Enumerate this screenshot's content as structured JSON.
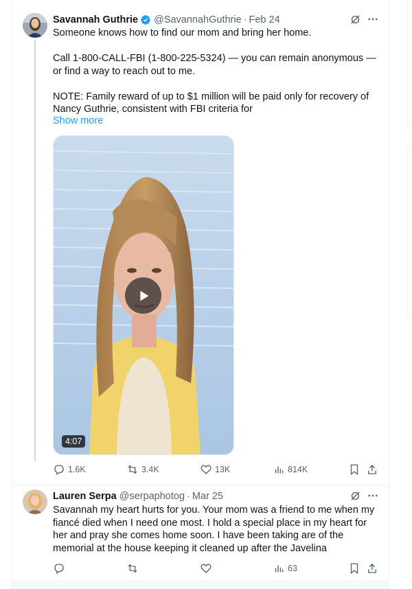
{
  "tweets": [
    {
      "author": "Savannah Guthrie",
      "handle": "@SavannahGuthrie",
      "separator": "·",
      "date": "Feb 24",
      "verified": true,
      "text": [
        "Someone knows how to find our mom and bring her home.",
        "Call 1-800-CALL-FBI (1-800-225-5324) — you can remain anonymous — or find a way to reach out to me.",
        "NOTE: Family reward of up to $1 million will be paid only for recovery of Nancy Guthrie, consistent with FBI criteria for"
      ],
      "show_more": "Show more",
      "video": {
        "duration": "4:07",
        "icon": "play-icon"
      },
      "stats": {
        "replies": "1.6K",
        "reposts": "3.4K",
        "likes": "13K",
        "views": "814K"
      }
    },
    {
      "author": "Lauren Serpa",
      "handle": "@serpaphotog",
      "separator": "·",
      "date": "Mar 25",
      "verified": false,
      "text": [
        "Savannah my heart hurts for you. Your mom was a friend to me when my fiancé  died when I need one most. I hold a special place in my heart for her and pray she comes home soon. I have been taking are of the memorial at the house keeping it cleaned up after the Javelina"
      ],
      "stats": {
        "replies": "",
        "reposts": "",
        "likes": "",
        "views": "63"
      }
    }
  ],
  "icons": {
    "grok": "grok-icon",
    "more": "more-icon",
    "reply": "reply-icon",
    "repost": "repost-icon",
    "like": "like-icon",
    "views": "views-icon",
    "bookmark": "bookmark-icon",
    "share": "share-icon",
    "verified": "verified-badge-icon"
  },
  "colors": {
    "link": "#1d9bf0",
    "verified": "#1d9bf0",
    "secondary_text": "#536471"
  }
}
